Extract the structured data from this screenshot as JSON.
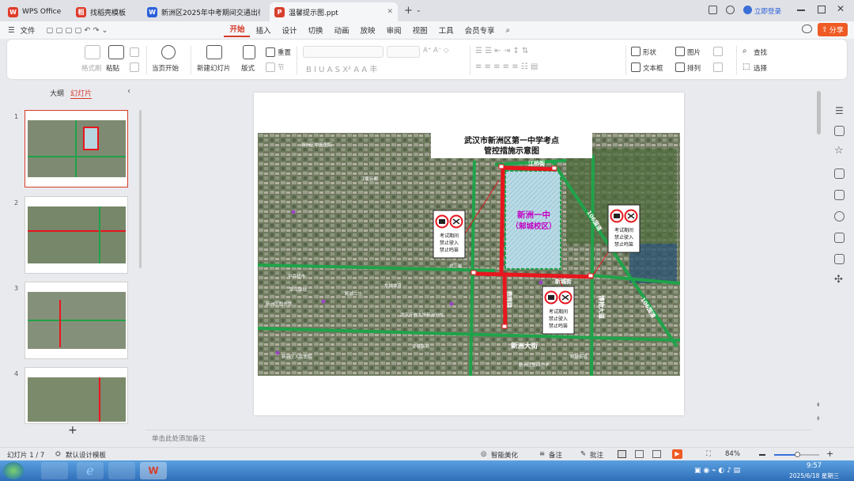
{
  "tabs": [
    {
      "label": "WPS Office",
      "logo": "W",
      "color": "#e03a2a"
    },
    {
      "label": "找稻壳模板",
      "logo": "稻",
      "color": "#e03a2a"
    },
    {
      "label": "新洲区2025年中考期间交通出行温馨",
      "logo": "W",
      "color": "#2b5fd9"
    },
    {
      "label": "温馨提示图.ppt",
      "logo": "P",
      "color": "#d6402c"
    }
  ],
  "titlebar": {
    "login": "立即登录",
    "new_tab": "+"
  },
  "menu": {
    "file": "文件",
    "items": [
      "开始",
      "插入",
      "设计",
      "切换",
      "动画",
      "放映",
      "审阅",
      "视图",
      "工具",
      "会员专享"
    ],
    "share": "分享"
  },
  "ribbon": {
    "format_painter": "格式刷",
    "paste": "粘贴",
    "from_current": "当页开始",
    "new_slide": "新建幻灯片",
    "layout": "版式",
    "reset": "重置",
    "section": "节",
    "shape": "形状",
    "image": "图片",
    "textbox": "文本框",
    "arrange": "排列",
    "find": "查找",
    "select": "选择"
  },
  "sidebar": {
    "outline_tab": "大纲",
    "slides_tab": "幻灯片",
    "add": "+",
    "numbers": [
      "1",
      "2",
      "3",
      "4"
    ]
  },
  "slide": {
    "title_line1": "武汉市新洲区第一中学考点",
    "title_line2": "管控措施示意图",
    "school_name": "新洲一中",
    "campus": "（邾城校区）",
    "sign_text": [
      "考试期间",
      "禁止驶入",
      "禁止鸣笛"
    ],
    "roads": {
      "jiangqiao": "江桥街",
      "xincheng": "新城街",
      "xinzhou_ave": "新洲大街",
      "bowu": "博物大道",
      "road106": "106国道",
      "education": "教育路"
    },
    "map_labels": [
      "新洲区中医医院",
      "江夏新都",
      "刘三畈",
      "中百超市",
      "东城体育",
      "邾城二中",
      "武汉开放大学新洲分校",
      "新洲区图书馆",
      "菜鸟驿站",
      "安泰新苑",
      "新洲区人民医院",
      "新洲区第四小学",
      "邾城街道"
    ]
  },
  "notes": {
    "placeholder": "单击此处添加备注"
  },
  "status": {
    "slide_counter": "幻灯片 1 / 7",
    "template": "默认设计模板",
    "beautify": "智能美化",
    "remarks": "备注",
    "annotate": "批注",
    "zoom": "84%"
  },
  "clock": {
    "time": "9:57",
    "date": "2025/6/18 星期三"
  },
  "colors": {
    "accent": "#d63b2a",
    "road_red": "#e8161e",
    "road_green": "#1fa34a",
    "school_text": "#c400c4"
  }
}
